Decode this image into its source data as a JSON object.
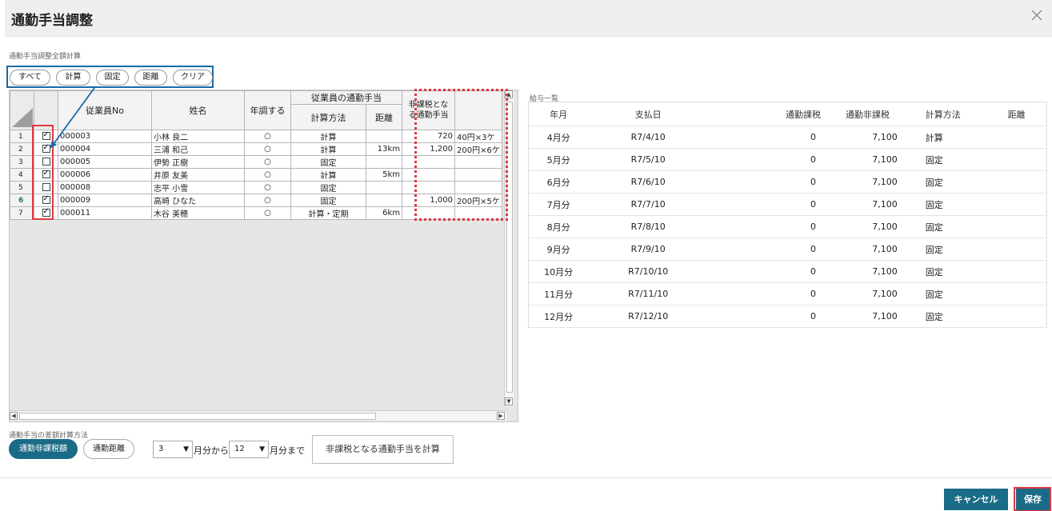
{
  "dialog": {
    "title": "通勤手当調整"
  },
  "section": {
    "total_calc_label": "通勤手当調整全額計算",
    "diff_method_label": "通勤手当の差額計算方法"
  },
  "filter_buttons": [
    "すべて",
    "計算",
    "固定",
    "距離",
    "クリア"
  ],
  "grid": {
    "headers": {
      "employee_no": "従業員No",
      "name": "姓名",
      "year_adjust": "年調する",
      "allowance_group": "従業員の通勤手当",
      "calc_method": "計算方法",
      "distance": "距離",
      "nontax_line1": "非課税とな",
      "nontax_line2": "る通勤手当"
    },
    "rows": [
      {
        "n": "1",
        "checked": true,
        "no": "000003",
        "name": "小林 良二",
        "adj": "○",
        "method": "計算",
        "dist": "",
        "amount": "720",
        "note": "40円×3ケ"
      },
      {
        "n": "2",
        "checked": true,
        "no": "000004",
        "name": "三浦 和己",
        "adj": "○",
        "method": "計算",
        "dist": "13km",
        "amount": "1,200",
        "note": "200円×6ケ"
      },
      {
        "n": "3",
        "checked": false,
        "no": "000005",
        "name": "伊勢 正樹",
        "adj": "○",
        "method": "固定",
        "dist": "",
        "amount": "",
        "note": ""
      },
      {
        "n": "4",
        "checked": true,
        "no": "000006",
        "name": "井原 友美",
        "adj": "○",
        "method": "計算",
        "dist": "5km",
        "amount": "",
        "note": ""
      },
      {
        "n": "5",
        "checked": false,
        "no": "000008",
        "name": "志平 小雪",
        "adj": "○",
        "method": "固定",
        "dist": "",
        "amount": "",
        "note": ""
      },
      {
        "n": "6",
        "checked": true,
        "no": "000009",
        "name": "高崎 ひなた",
        "adj": "○",
        "method": "固定",
        "dist": "",
        "amount": "1,000",
        "note": "200円×5ケ"
      },
      {
        "n": "7",
        "checked": true,
        "no": "000011",
        "name": "木谷 美穂",
        "adj": "○",
        "method": "計算・定期",
        "dist": "6km",
        "amount": "",
        "note": ""
      }
    ]
  },
  "payroll": {
    "label": "給与一覧",
    "headers": [
      "年月",
      "支払日",
      "通勤課税",
      "通勤非課税",
      "計算方法",
      "距離"
    ],
    "rows": [
      [
        "4月分",
        "R7/4/10",
        "0",
        "7,100",
        "計算",
        ""
      ],
      [
        "5月分",
        "R7/5/10",
        "0",
        "7,100",
        "固定",
        ""
      ],
      [
        "6月分",
        "R7/6/10",
        "0",
        "7,100",
        "固定",
        ""
      ],
      [
        "7月分",
        "R7/7/10",
        "0",
        "7,100",
        "固定",
        ""
      ],
      [
        "8月分",
        "R7/8/10",
        "0",
        "7,100",
        "固定",
        ""
      ],
      [
        "9月分",
        "R7/9/10",
        "0",
        "7,100",
        "固定",
        ""
      ],
      [
        "10月分",
        "R7/10/10",
        "0",
        "7,100",
        "固定",
        ""
      ],
      [
        "11月分",
        "R7/11/10",
        "0",
        "7,100",
        "固定",
        ""
      ],
      [
        "12月分",
        "R7/12/10",
        "0",
        "7,100",
        "固定",
        ""
      ]
    ]
  },
  "diff": {
    "mode_nontax": "通勤非課税額",
    "mode_distance": "通勤距離",
    "from_month": "3",
    "from_suffix": "月分から",
    "to_month": "12",
    "to_suffix": "月分まで",
    "calc_button": "非課税となる通勤手当を計算"
  },
  "footer": {
    "cancel": "キャンセル",
    "save": "保存"
  },
  "colors": {
    "accent": "#1a6b87",
    "highlight": "#e0383f",
    "callout": "#1a6aa6"
  }
}
